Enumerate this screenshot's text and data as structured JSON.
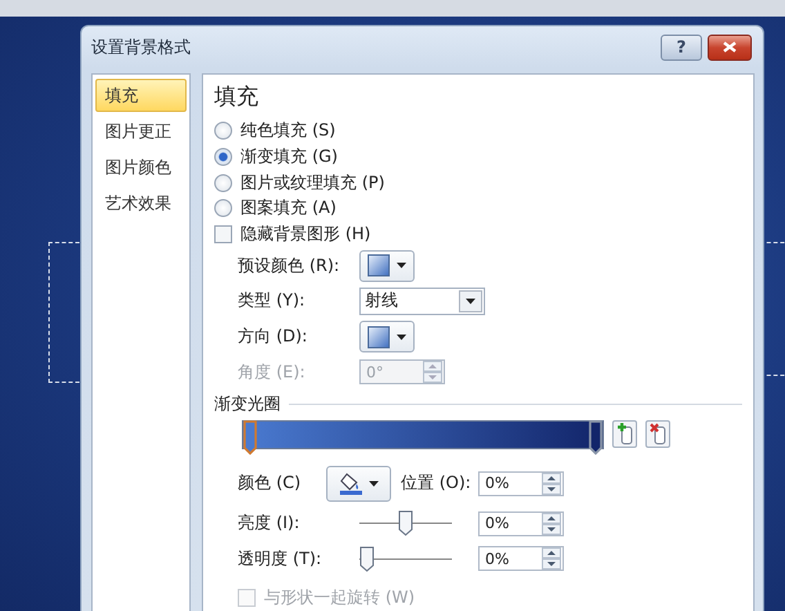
{
  "window": {
    "title": "设置背景格式",
    "help": "?"
  },
  "sidebar": {
    "items": [
      {
        "label": "填充",
        "selected": true
      },
      {
        "label": "图片更正",
        "selected": false
      },
      {
        "label": "图片颜色",
        "selected": false
      },
      {
        "label": "艺术效果",
        "selected": false
      }
    ]
  },
  "panel": {
    "heading": "填充",
    "fill_options": [
      {
        "label": "纯色填充 (S)",
        "selected": false
      },
      {
        "label": "渐变填充 (G)",
        "selected": true
      },
      {
        "label": "图片或纹理填充 (P)",
        "selected": false
      },
      {
        "label": "图案填充 (A)",
        "selected": false
      }
    ],
    "hide_background": {
      "label": "隐藏背景图形 (H)",
      "checked": false
    },
    "preset_color": {
      "label": "预设颜色 (R):"
    },
    "type": {
      "label": "类型 (Y):",
      "value": "射线"
    },
    "direction": {
      "label": "方向 (D):"
    },
    "angle": {
      "label": "角度 (E):",
      "value": "0°",
      "disabled": true
    },
    "gradient_stops": {
      "label": "渐变光圈",
      "stops": [
        {
          "level": 0,
          "selected": true,
          "color": "#4a7ad0"
        },
        {
          "level": 1,
          "selected": false,
          "color": "#12256a"
        }
      ]
    },
    "color": {
      "label": "颜色 (C)"
    },
    "position": {
      "label": "位置 (O):",
      "value": "0%"
    },
    "brightness": {
      "label": "亮度 (I):",
      "level": 0.5,
      "value": "0%"
    },
    "transparency": {
      "label": "透明度 (T):",
      "level": 0,
      "value": "0%"
    },
    "rotate_with_shape": {
      "label": "与形状一起旋转 (W)",
      "checked": false,
      "disabled": true
    }
  }
}
